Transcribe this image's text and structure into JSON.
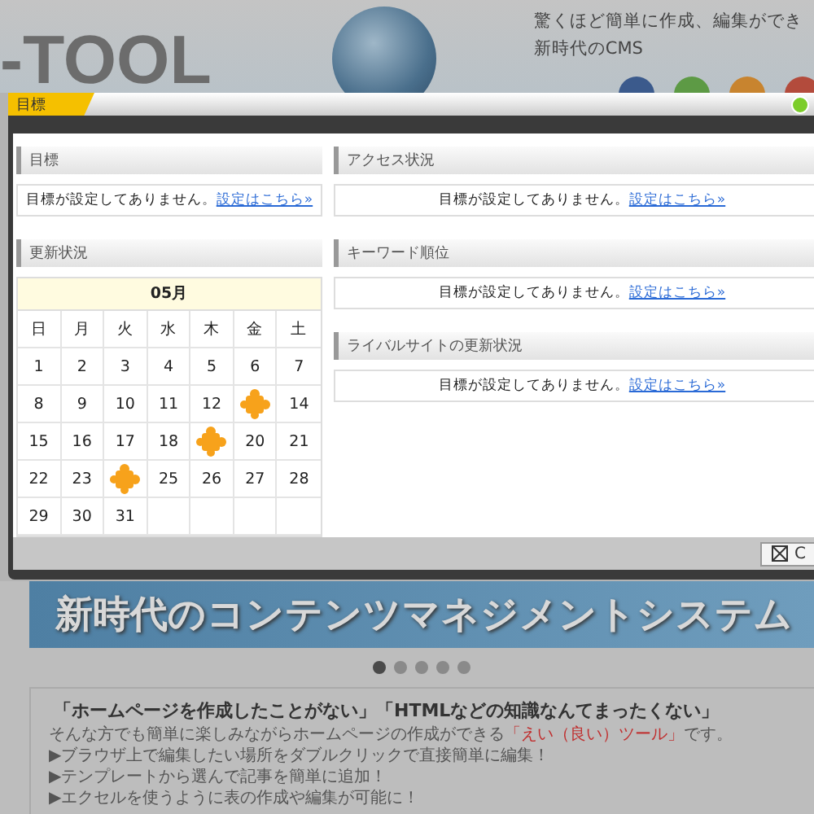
{
  "page": {
    "logo": "-TOOL",
    "tagline": [
      "驚くほど簡単に作成、編集ができ",
      "新時代のCMS"
    ],
    "banner": "新時代のコンテンツマネジメントシステム",
    "slides": [
      {
        "selected": true
      },
      {
        "selected": false
      },
      {
        "selected": false
      },
      {
        "selected": false
      },
      {
        "selected": false
      }
    ],
    "intro": {
      "heading": "「ホームページを作成したことがない」「HTMLなどの知識なんてまったくない」",
      "lead": {
        "text": "そんな方でも簡単に楽しみながらホームページの作成ができる",
        "highlight": "「えい（良い）ツール」",
        "after": "です。"
      },
      "features": [
        "▶ブラウザ上で編集したい場所をダブルクリックで直接簡単に編集！",
        "▶テンプレートから選んで記事を簡単に追加！",
        "▶エクセルを使うように表の作成や編集が可能に！"
      ]
    }
  },
  "dialog": {
    "tab": {
      "label": "目標",
      "selected": true
    },
    "indicator": {
      "on": true
    },
    "left": [
      {
        "kind": "message",
        "title": "目標",
        "message": "目標が設定してありません。",
        "link": "設定はこちら»"
      },
      {
        "kind": "calendar",
        "title": "更新状況",
        "month": "05月",
        "weekdays": [
          "日",
          "月",
          "火",
          "水",
          "木",
          "金",
          "土"
        ],
        "cells": [
          {
            "kind": "date",
            "day": "1"
          },
          {
            "kind": "date",
            "day": "2"
          },
          {
            "kind": "date",
            "day": "3"
          },
          {
            "kind": "date",
            "day": "4"
          },
          {
            "kind": "date",
            "day": "5"
          },
          {
            "kind": "date",
            "day": "6"
          },
          {
            "kind": "date",
            "day": "7"
          },
          {
            "kind": "date",
            "day": "8"
          },
          {
            "kind": "date",
            "day": "9"
          },
          {
            "kind": "date",
            "day": "10"
          },
          {
            "kind": "date",
            "day": "11"
          },
          {
            "kind": "date",
            "day": "12"
          },
          {
            "kind": "event"
          },
          {
            "kind": "date",
            "day": "14"
          },
          {
            "kind": "date",
            "day": "15"
          },
          {
            "kind": "date",
            "day": "16"
          },
          {
            "kind": "date",
            "day": "17"
          },
          {
            "kind": "date",
            "day": "18"
          },
          {
            "kind": "event"
          },
          {
            "kind": "date",
            "day": "20"
          },
          {
            "kind": "date",
            "day": "21"
          },
          {
            "kind": "date",
            "day": "22"
          },
          {
            "kind": "date",
            "day": "23"
          },
          {
            "kind": "event"
          },
          {
            "kind": "date",
            "day": "25"
          },
          {
            "kind": "date",
            "day": "26"
          },
          {
            "kind": "date",
            "day": "27"
          },
          {
            "kind": "date",
            "day": "28"
          },
          {
            "kind": "date",
            "day": "29"
          },
          {
            "kind": "date",
            "day": "30"
          },
          {
            "kind": "date",
            "day": "31"
          }
        ]
      }
    ],
    "right": [
      {
        "kind": "message",
        "title": "アクセス状況",
        "message": "目標が設定してありません。",
        "link": "設定はこちら»"
      },
      {
        "kind": "message",
        "title": "キーワード順位",
        "message": "目標が設定してありません。",
        "link": "設定はこちら»"
      },
      {
        "kind": "message",
        "title": "ライバルサイトの更新状況",
        "message": "目標が設定してありません。",
        "link": "設定はこちら»"
      }
    ],
    "close": {
      "label": "C"
    }
  }
}
